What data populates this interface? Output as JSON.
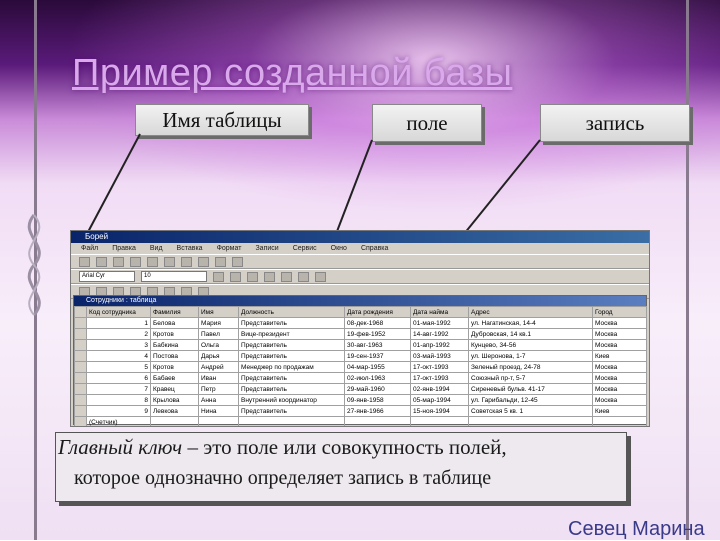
{
  "title": "Пример созданной базы",
  "callouts": {
    "table_name": "Имя таблицы",
    "field": "поле",
    "record": "запись"
  },
  "app": {
    "window_title": "Борей",
    "menu": [
      "Файл",
      "Правка",
      "Вид",
      "Вставка",
      "Формат",
      "Записи",
      "Сервис",
      "Окно",
      "Справка"
    ],
    "font_name": "Arial Cyr",
    "font_size": "10",
    "table_window_title": "Сотрудники : таблица",
    "columns": [
      "Код сотрудника",
      "Фамилия",
      "Имя",
      "Должность",
      "Дата рождения",
      "Дата найма",
      "Адрес",
      "Город"
    ],
    "rows": [
      [
        "1",
        "Белова",
        "Мария",
        "Представитель",
        "08-дек-1968",
        "01-мая-1992",
        "ул. Нагатинская, 14-4",
        "Москва"
      ],
      [
        "2",
        "Кротов",
        "Павел",
        "Вице-президент",
        "19-фев-1952",
        "14-авг-1992",
        "Дубровская, 14 кв.1",
        "Москва"
      ],
      [
        "3",
        "Бабкина",
        "Ольга",
        "Представитель",
        "30-авг-1963",
        "01-апр-1992",
        "Кунцево, 34-56",
        "Москва"
      ],
      [
        "4",
        "Постова",
        "Дарья",
        "Представитель",
        "19-сен-1937",
        "03-май-1993",
        "ул. Шеронова, 1-7",
        "Киев"
      ],
      [
        "5",
        "Кротов",
        "Андрей",
        "Менеджер по продажам",
        "04-мар-1955",
        "17-окт-1993",
        "Зеленый проезд, 24-78",
        "Москва"
      ],
      [
        "6",
        "Бабаев",
        "Иван",
        "Представитель",
        "02-июл-1963",
        "17-окт-1993",
        "Союзный пр-т, 5-7",
        "Москва"
      ],
      [
        "7",
        "Кравец",
        "Петр",
        "Представитель",
        "29-май-1960",
        "02-янв-1994",
        "Сиреневый бульв. 41-17",
        "Москва"
      ],
      [
        "8",
        "Крылова",
        "Анна",
        "Внутренний координатор",
        "09-янв-1958",
        "05-мар-1994",
        "ул. Гарибальди, 12-45",
        "Москва"
      ],
      [
        "9",
        "Левкова",
        "Нина",
        "Представитель",
        "27-янв-1966",
        "15-ноя-1994",
        "Советская 5 кв. 1",
        "Киев"
      ]
    ],
    "new_row_label": "(Счетчик)"
  },
  "definition": {
    "term": "Главный ключ",
    "rest": " – это поле или совокупность полей,",
    "line2": "которое однозначно определяет запись в таблице"
  },
  "author": "Севец Марина"
}
